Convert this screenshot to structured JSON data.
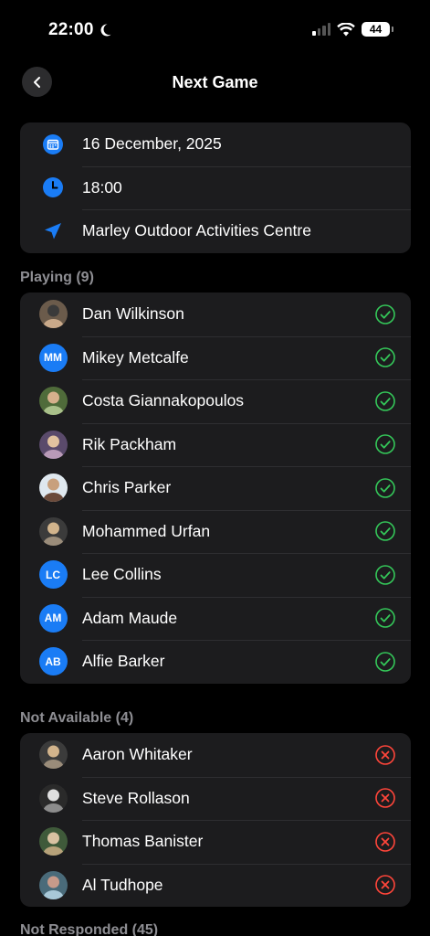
{
  "status_bar": {
    "time": "22:00",
    "battery": "44"
  },
  "nav": {
    "title": "Next Game"
  },
  "details": {
    "date": "16 December, 2025",
    "time": "18:00",
    "location": "Marley Outdoor Activities Centre"
  },
  "colors": {
    "accent": "#1a7cf5",
    "available": "#34c759",
    "unavailable": "#ff453a"
  },
  "sections": {
    "playing": {
      "label": "Playing (9)",
      "players": [
        {
          "name": "Dan Wilkinson",
          "avatar": "photo"
        },
        {
          "name": "Mikey Metcalfe",
          "avatar": "MM"
        },
        {
          "name": "Costa Giannakopoulos",
          "avatar": "photo"
        },
        {
          "name": "Rik Packham",
          "avatar": "photo"
        },
        {
          "name": "Chris Parker",
          "avatar": "photo"
        },
        {
          "name": "Mohammed Urfan",
          "avatar": "photo"
        },
        {
          "name": "Lee Collins",
          "avatar": "LC"
        },
        {
          "name": "Adam Maude",
          "avatar": "AM"
        },
        {
          "name": "Alfie Barker",
          "avatar": "AB"
        }
      ]
    },
    "not_available": {
      "label": "Not Available (4)",
      "players": [
        {
          "name": "Aaron Whitaker",
          "avatar": "photo"
        },
        {
          "name": "Steve Rollason",
          "avatar": "photo"
        },
        {
          "name": "Thomas Banister",
          "avatar": "photo"
        },
        {
          "name": "Al Tudhope",
          "avatar": "photo"
        }
      ]
    },
    "not_responded": {
      "label": "Not Responded (45)"
    }
  }
}
